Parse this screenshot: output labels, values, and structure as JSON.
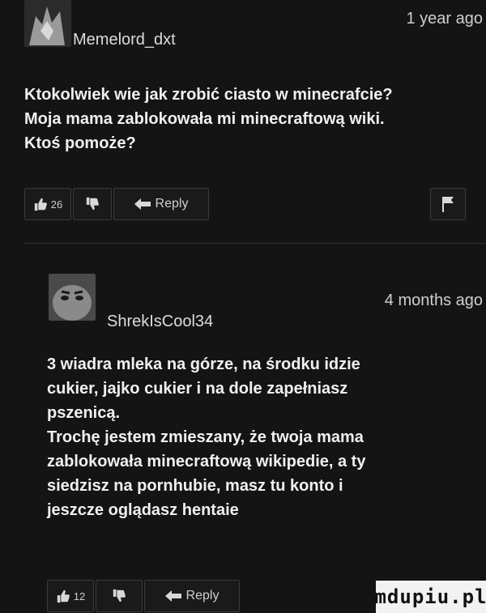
{
  "comments": [
    {
      "username": "Memelord_dxt",
      "timestamp": "1 year ago",
      "text": "Ktokolwiek wie jak zrobić ciasto w minecrafcie?\nMoja mama zablokowała mi minecraftową wiki.\nKtoś pomoże?",
      "like_count": "26",
      "reply_label": "Reply",
      "avatar_icon": "avatar-image",
      "flag_icon": "flag-icon"
    },
    {
      "username": "ShrekIsCool34",
      "timestamp": "4 months ago",
      "text": "3 wiadra mleka na górze, na środku idzie\ncukier, jajko cukier i na dole zapełniasz\npszenicą.\nTrochę jestem zmieszany, że twoja mama\nzablokowała minecraftową wikipedie, a ty\nsiedzisz na pornhubie, masz tu konto i\njeszcze oglądasz hentaie",
      "like_count": "12",
      "reply_label": "Reply",
      "avatar_icon": "avatar-image"
    }
  ],
  "watermark": "mdupiu.pl",
  "colors": {
    "background": "#141414",
    "text": "#f0f0f0",
    "button_border": "#3a3a3a"
  }
}
